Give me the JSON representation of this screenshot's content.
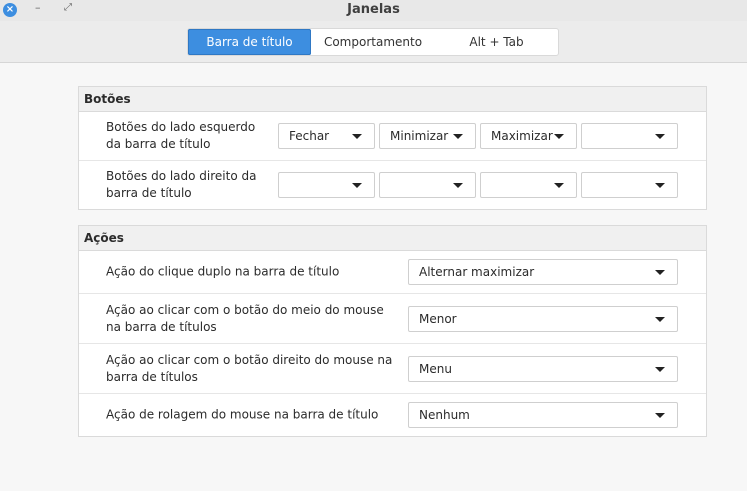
{
  "window": {
    "title": "Janelas"
  },
  "tabs": [
    {
      "label": "Barra de título",
      "active": true
    },
    {
      "label": "Comportamento",
      "active": false
    },
    {
      "label": "Alt + Tab",
      "active": false
    }
  ],
  "buttons_group": {
    "heading": "Botões",
    "left": {
      "label": "Botões do lado esquerdo da barra de título",
      "values": [
        "Fechar",
        "Minimizar",
        "Maximizar",
        ""
      ]
    },
    "right": {
      "label": "Botões do lado direito da barra de título",
      "values": [
        "",
        "",
        "",
        ""
      ]
    }
  },
  "actions_group": {
    "heading": "Ações",
    "rows": [
      {
        "label": "Ação do clique duplo na barra de título",
        "value": "Alternar maximizar"
      },
      {
        "label": "Ação ao clicar com o botão do meio do mouse na barra de títulos",
        "value": "Menor"
      },
      {
        "label": "Ação ao clicar com o botão direito do mouse na barra de títulos",
        "value": "Menu"
      },
      {
        "label": "Ação de rolagem do mouse na barra de título",
        "value": "Nenhum"
      }
    ]
  },
  "colors": {
    "accent": "#3d8ee0"
  },
  "icons": {
    "close": "close-icon",
    "minimize": "minimize-icon",
    "maximize": "maximize-icon",
    "dropdown": "chevron-down-icon"
  }
}
